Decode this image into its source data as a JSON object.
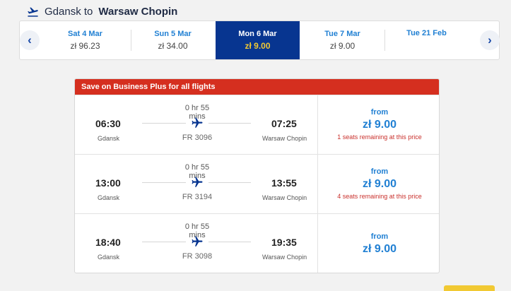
{
  "route": {
    "origin_prefix": "Gdansk to",
    "destination": "Warsaw Chopin"
  },
  "dates": [
    {
      "day": "Sat 4 Mar",
      "price": "zł 96.23",
      "active": false
    },
    {
      "day": "Sun 5 Mar",
      "price": "zł 34.00",
      "active": false
    },
    {
      "day": "Mon 6 Mar",
      "price": "zł 9.00",
      "active": true
    },
    {
      "day": "Tue 7 Mar",
      "price": "zł 9.00",
      "active": false
    },
    {
      "day": "Tue 21 Feb",
      "price": "",
      "active": false
    }
  ],
  "nav": {
    "prev": "‹",
    "next": "›"
  },
  "banner": "Save on Business Plus for all flights",
  "flights": [
    {
      "depart_time": "06:30",
      "depart_city": "Gdansk",
      "arrive_time": "07:25",
      "arrive_city": "Warsaw Chopin",
      "duration": "0 hr 55 mins",
      "flight_number": "FR 3096",
      "price_from": "from",
      "price": "zł 9.00",
      "seats_note": "1 seats remaining at this price"
    },
    {
      "depart_time": "13:00",
      "depart_city": "Gdansk",
      "arrive_time": "13:55",
      "arrive_city": "Warsaw Chopin",
      "duration": "0 hr 55 mins",
      "flight_number": "FR 3194",
      "price_from": "from",
      "price": "zł 9.00",
      "seats_note": "4 seats remaining at this price"
    },
    {
      "depart_time": "18:40",
      "depart_city": "Gdansk",
      "arrive_time": "19:35",
      "arrive_city": "Warsaw Chopin",
      "duration": "0 hr 55 mins",
      "flight_number": "FR 3098",
      "price_from": "from",
      "price": "zł 9.00",
      "seats_note": ""
    }
  ],
  "icons": {
    "header": "plane-takeoff-icon",
    "flight": "plane-icon"
  },
  "colors": {
    "active_date_bg": "#073590",
    "active_price": "#f1c933",
    "link_blue": "#2180d3",
    "banner_red": "#d52f1f"
  }
}
